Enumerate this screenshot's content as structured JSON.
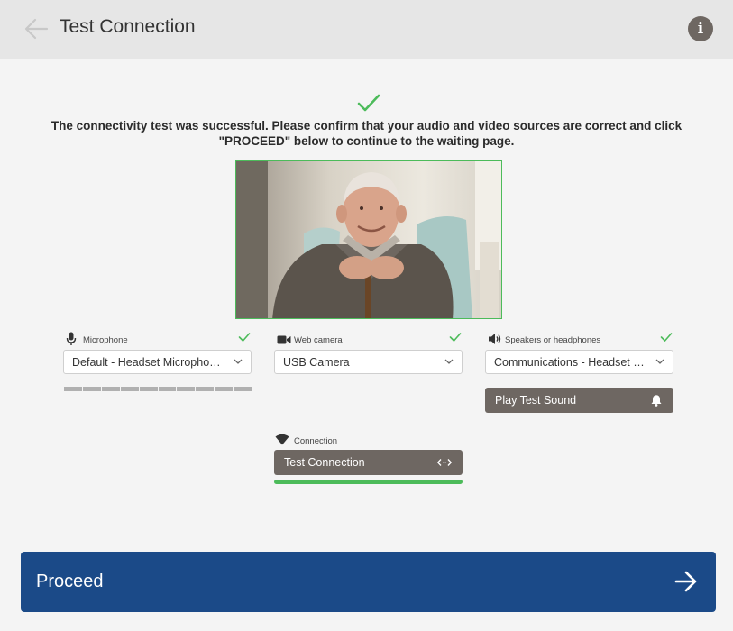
{
  "header": {
    "title": "Test Connection",
    "back_icon": "arrow-left-icon",
    "info_icon": "info-icon",
    "info_glyph": "i"
  },
  "status": {
    "icon": "check-icon",
    "message": "The connectivity test was successful. Please confirm that your audio and video sources are correct and click \"PROCEED\" below to continue to the waiting page."
  },
  "video": {
    "description": "camera-preview"
  },
  "devices": {
    "microphone": {
      "label": "Microphone",
      "icon": "microphone-icon",
      "selected": "Default - Headset Microphone (Headset)",
      "ok": true,
      "level_segments": 10
    },
    "camera": {
      "label": "Web camera",
      "icon": "video-camera-icon",
      "selected": "USB Camera",
      "ok": true
    },
    "speakers": {
      "label": "Speakers or headphones",
      "icon": "speaker-icon",
      "selected": "Communications - Headset Earphone (Headset)",
      "ok": true,
      "test_button": "Play Test Sound",
      "test_icon": "bell-icon"
    }
  },
  "connection": {
    "label": "Connection",
    "icon": "wifi-icon",
    "button": "Test Connection",
    "button_icon": "code-arrows-icon",
    "progress": 1.0
  },
  "footer": {
    "proceed_label": "Proceed",
    "proceed_icon": "arrow-right-icon"
  },
  "colors": {
    "accent_green": "#4cbb5a",
    "primary_blue": "#1b4a88",
    "button_gray": "#6e6762",
    "header_bg": "#e6e6e6"
  }
}
